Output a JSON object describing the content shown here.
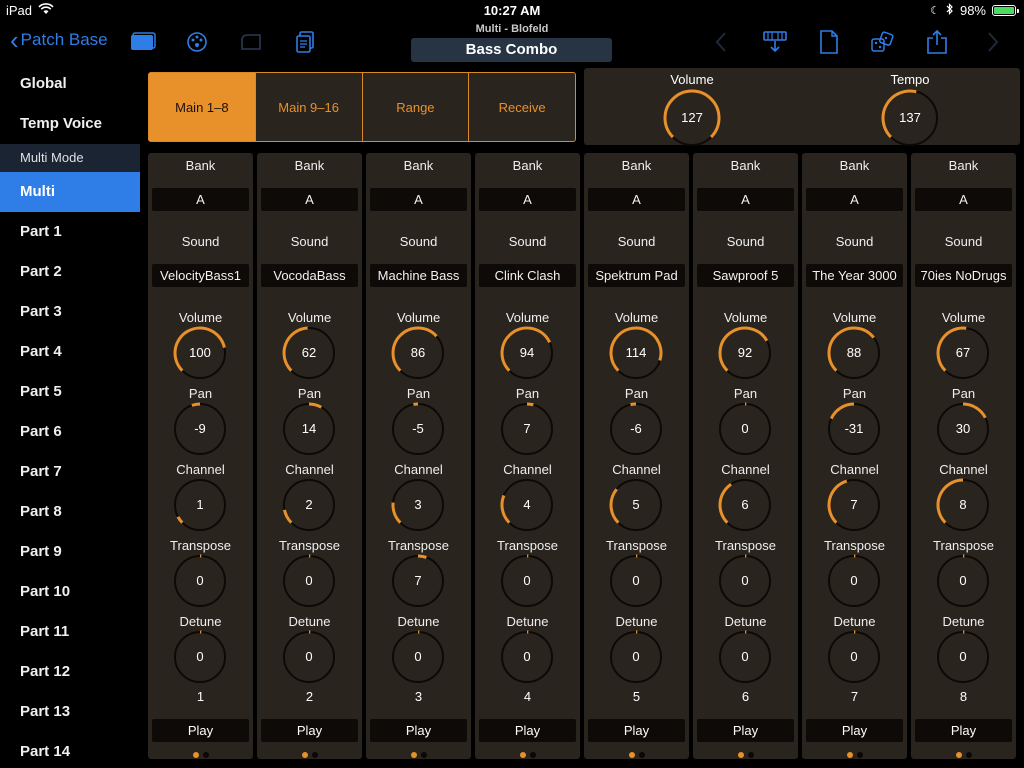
{
  "status": {
    "carrier": "iPad",
    "time": "10:27 AM",
    "battery": "98%",
    "battery_level": 0.98
  },
  "nav": {
    "back_label": "Patch Base",
    "subtitle": "Multi - Blofeld",
    "title": "Bass Combo"
  },
  "sidebar": {
    "items": [
      {
        "label": "Global"
      },
      {
        "label": "Temp Voice"
      }
    ],
    "section": "Multi Mode",
    "multi_items": [
      {
        "label": "Multi",
        "active": true
      },
      {
        "label": "Part 1"
      },
      {
        "label": "Part 2"
      },
      {
        "label": "Part 3"
      },
      {
        "label": "Part 4"
      },
      {
        "label": "Part 5"
      },
      {
        "label": "Part 6"
      },
      {
        "label": "Part 7"
      },
      {
        "label": "Part 8"
      },
      {
        "label": "Part 9"
      },
      {
        "label": "Part 10"
      },
      {
        "label": "Part 11"
      },
      {
        "label": "Part 12"
      },
      {
        "label": "Part 13"
      },
      {
        "label": "Part 14"
      }
    ]
  },
  "tabs": [
    {
      "label": "Main 1–8",
      "active": true
    },
    {
      "label": "Main 9–16"
    },
    {
      "label": "Range"
    },
    {
      "label": "Receive"
    }
  ],
  "master": {
    "volume_label": "Volume",
    "volume": 127,
    "volume_level": 1.0,
    "tempo_label": "Tempo",
    "tempo": 137,
    "tempo_level": 0.55
  },
  "strip_labels": {
    "bank": "Bank",
    "sound": "Sound",
    "volume": "Volume",
    "pan": "Pan",
    "channel": "Channel",
    "transpose": "Transpose",
    "detune": "Detune",
    "play": "Play"
  },
  "parts": [
    {
      "bank": "A",
      "sound": "VelocityBass1",
      "volume": 100,
      "pan": -9,
      "channel": 1,
      "transpose": 0,
      "detune": 0,
      "number": 1
    },
    {
      "bank": "A",
      "sound": "VocodaBass",
      "volume": 62,
      "pan": 14,
      "channel": 2,
      "transpose": 0,
      "detune": 0,
      "number": 2
    },
    {
      "bank": "A",
      "sound": "Machine Bass",
      "volume": 86,
      "pan": -5,
      "channel": 3,
      "transpose": 7,
      "detune": 0,
      "number": 3
    },
    {
      "bank": "A",
      "sound": "Clink Clash",
      "volume": 94,
      "pan": 7,
      "channel": 4,
      "transpose": 0,
      "detune": 0,
      "number": 4
    },
    {
      "bank": "A",
      "sound": "Spektrum Pad",
      "volume": 114,
      "pan": -6,
      "channel": 5,
      "transpose": 0,
      "detune": 0,
      "number": 5
    },
    {
      "bank": "A",
      "sound": "Sawproof 5",
      "volume": 92,
      "pan": 0,
      "channel": 6,
      "transpose": 0,
      "detune": 0,
      "number": 6
    },
    {
      "bank": "A",
      "sound": "The Year 3000",
      "volume": 88,
      "pan": -31,
      "channel": 7,
      "transpose": 0,
      "detune": 0,
      "number": 7
    },
    {
      "bank": "A",
      "sound": "70ies NoDrugs",
      "volume": 67,
      "pan": 30,
      "channel": 8,
      "transpose": 0,
      "detune": 0,
      "number": 8
    }
  ],
  "colors": {
    "accent": "#e8902a",
    "blue": "#2f7de6",
    "panel": "#2a241e"
  },
  "icons": [
    "wifi-icon",
    "moon-icon",
    "bluetooth-icon",
    "battery-icon",
    "folder-icon",
    "palette-icon",
    "piano-icon",
    "copy-icon",
    "chevron-left-icon",
    "download-icon",
    "document-icon",
    "dice-icon",
    "share-icon",
    "chevron-right-icon"
  ]
}
